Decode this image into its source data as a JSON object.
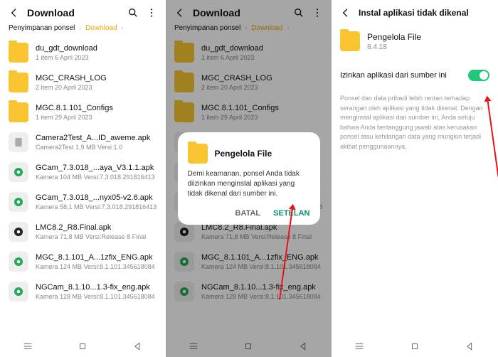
{
  "panel1": {
    "title": "Download",
    "crumb1": "Penyimpanan ponsel",
    "crumb2": "Download",
    "items": [
      {
        "name": "du_gdt_download",
        "sub": "1 item    6 April 2023",
        "kind": "folder"
      },
      {
        "name": "MGC_CRASH_LOG",
        "sub": "2 item    20 April 2023",
        "kind": "folder"
      },
      {
        "name": "MGC.8.1.101_Configs",
        "sub": "1 item    29 April 2023",
        "kind": "folder"
      },
      {
        "name": "Camera2Test_A...ID_aweme.apk",
        "sub": "Camera2Test    1,9 MB    Versi:1.0",
        "kind": "apk-generic"
      },
      {
        "name": "GCam_7.3.018_...aya_V3.1.1.apk",
        "sub": "Kamera    104 MB    Versi:7.3.018.291816413",
        "kind": "apk-cam"
      },
      {
        "name": "GCam_7.3.018_...nyx05-v2.6.apk",
        "sub": "Kamera    58,1 MB    Versi:7.3.018.291816413",
        "kind": "apk-cam"
      },
      {
        "name": "LMC8.2_R8.Final.apk",
        "sub": "Kamera    71,8 MB    Versi:Release 8 Final",
        "kind": "apk-lmc"
      },
      {
        "name": "MGC_8.1.101_A...1zfix_ENG.apk",
        "sub": "Kamera    124 MB    Versi:8.1.101.345618084",
        "kind": "apk-cam"
      },
      {
        "name": "NGCam_8.1.10...1.3-fix_eng.apk",
        "sub": "Kamera    128 MB    Versi:8.1.101.345618084",
        "kind": "apk-cam"
      }
    ]
  },
  "panel2": {
    "title": "Download",
    "crumb1": "Penyimpanan ponsel",
    "crumb2": "Download",
    "dialog": {
      "title": "Pengelola File",
      "body": "Demi keamanan, ponsel Anda tidak diizinkan menginstal aplikasi yang tidak dikenal dari sumber ini.",
      "cancel": "BATAL",
      "settings": "SETELAN"
    }
  },
  "panel3": {
    "title": "Instal aplikasi tidak dikenal",
    "app": {
      "name": "Pengelola File",
      "version": "8.4.18"
    },
    "toggle_label": "Izinkan aplikasi dari sumber ini",
    "warning": "Ponsel dan data pribadi lebih rentan terhadap serangan oleh aplikasi yang tidak dikenal. Dengan menginstal aplikasi dari sumber ini, Anda setuju bahwa Anda bertanggung jawab atas kerusakan ponsel atau kehilangan data yang mungkin terjadi akibat penggunaannya."
  }
}
